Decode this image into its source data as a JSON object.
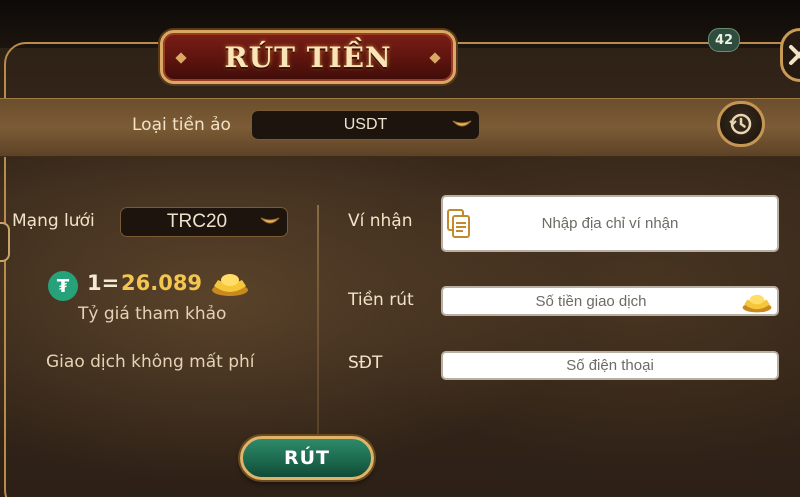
{
  "dialog": {
    "title": "RÚT TIỀN",
    "level_badge": "42"
  },
  "currency": {
    "label": "Loại tiền ảo",
    "selected": "USDT"
  },
  "network": {
    "label": "Mạng lưới",
    "selected": "TRC20"
  },
  "rate": {
    "prefix": "1=",
    "value": "26.089",
    "caption": "Tỷ giá tham khảo"
  },
  "fee_note": "Giao dịch không mất phí",
  "form": {
    "wallet_label": "Ví nhận",
    "wallet_placeholder": "Nhập địa chỉ ví nhận",
    "amount_label": "Tiền rút",
    "amount_placeholder": "Số tiền giao dịch",
    "phone_label": "SĐT",
    "phone_placeholder": "Số điện thoại"
  },
  "submit_label": "RÚT",
  "colors": {
    "accent_gold": "#f2c64f",
    "tether_green": "#27a17a",
    "button_green": "#1c6a4f",
    "banner_red": "#5a130d"
  },
  "icons": [
    "close-icon",
    "history-icon",
    "chevron-down-icon",
    "tether-icon",
    "gold-ingot-icon",
    "paste-icon"
  ]
}
